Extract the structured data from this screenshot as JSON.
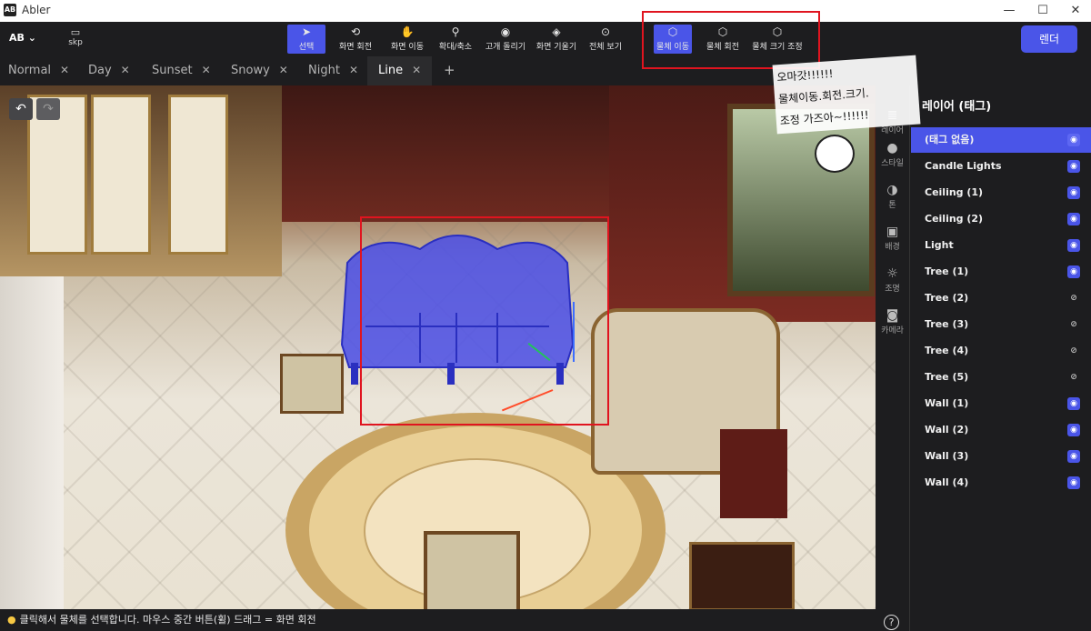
{
  "window": {
    "title": "Abler",
    "logo": "AB"
  },
  "toolbar": {
    "brand": "AB",
    "file_label": "skp",
    "tools": [
      {
        "label": "선택",
        "icon": "cursor-icon"
      },
      {
        "label": "화면 회전",
        "icon": "orbit-icon"
      },
      {
        "label": "화면 이동",
        "icon": "hand-icon"
      },
      {
        "label": "확대/축소",
        "icon": "zoom-icon"
      },
      {
        "label": "고개 돌리기",
        "icon": "look-around-icon"
      },
      {
        "label": "화면 기울기",
        "icon": "tilt-camera-icon"
      },
      {
        "label": "전체 보기",
        "icon": "fit-view-icon"
      },
      {
        "label": "물체 이동",
        "icon": "move-object-icon"
      },
      {
        "label": "물체 회전",
        "icon": "rotate-object-icon"
      },
      {
        "label": "물체 크기 조정",
        "icon": "scale-object-icon"
      }
    ],
    "render_label": "렌더"
  },
  "tabs": [
    "Normal",
    "Day",
    "Sunset",
    "Snowy",
    "Night",
    "Line"
  ],
  "active_tab": "Line",
  "rail": [
    {
      "label": "레이어",
      "icon": "layers-icon"
    },
    {
      "label": "스타일",
      "icon": "style-icon"
    },
    {
      "label": "톤",
      "icon": "tone-icon"
    },
    {
      "label": "배경",
      "icon": "background-icon"
    },
    {
      "label": "조명",
      "icon": "sun-icon"
    },
    {
      "label": "카메라",
      "icon": "camera-icon"
    }
  ],
  "layer_panel": {
    "title": "레이어 (태그)",
    "layers": [
      {
        "name": "(태그 없음)",
        "visible": true,
        "selected": true
      },
      {
        "name": "Candle Lights",
        "visible": true
      },
      {
        "name": "Ceiling (1)",
        "visible": true
      },
      {
        "name": "Ceiling (2)",
        "visible": true
      },
      {
        "name": "Light",
        "visible": true
      },
      {
        "name": "Tree (1)",
        "visible": true
      },
      {
        "name": "Tree (2)",
        "visible": false
      },
      {
        "name": "Tree (3)",
        "visible": false
      },
      {
        "name": "Tree (4)",
        "visible": false
      },
      {
        "name": "Tree (5)",
        "visible": false
      },
      {
        "name": "Wall (1)",
        "visible": true
      },
      {
        "name": "Wall (2)",
        "visible": true
      },
      {
        "name": "Wall (3)",
        "visible": true
      },
      {
        "name": "Wall (4)",
        "visible": true
      }
    ]
  },
  "status_text": "클릭해서 물체를 선택합니다. 마우스 중간 버튼(휠) 드래그 = 화면 회전",
  "annotation": {
    "lines": [
      "오마갓!!!!!!",
      "물체이동.회전.크기.",
      "조정 가즈아~!!!!!!"
    ]
  },
  "colors": {
    "accent": "#4a55e8",
    "annotation": "#e0141f"
  }
}
